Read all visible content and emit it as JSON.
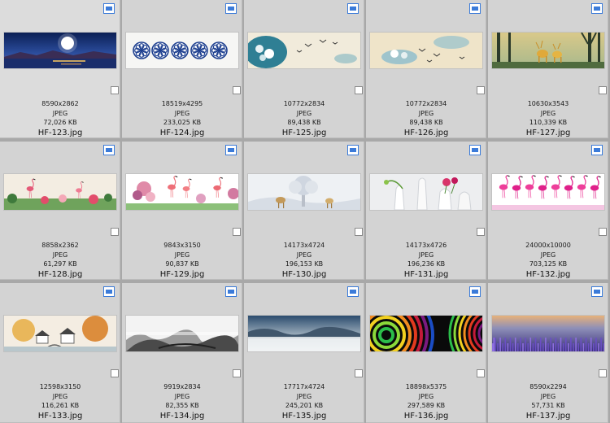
{
  "files": [
    {
      "name": "HF-123.jpg",
      "dims": "8590x2862",
      "type": "JPEG",
      "size": "72,026 KB",
      "thumb": "night-moon-lake"
    },
    {
      "name": "HF-124.jpg",
      "dims": "18519x4295",
      "type": "JPEG",
      "size": "233,025 KB",
      "thumb": "blue-porcelain-medallions"
    },
    {
      "name": "HF-125.jpg",
      "dims": "10772x2834",
      "type": "JPEG",
      "size": "89,438 KB",
      "thumb": "lotus-birds-teal"
    },
    {
      "name": "HF-126.jpg",
      "dims": "10772x2834",
      "type": "JPEG",
      "size": "89,438 KB",
      "thumb": "lotus-birds-cream"
    },
    {
      "name": "HF-127.jpg",
      "dims": "10630x3543",
      "type": "JPEG",
      "size": "110,339 KB",
      "thumb": "deer-forest-gold"
    },
    {
      "name": "HF-128.jpg",
      "dims": "8858x2362",
      "type": "JPEG",
      "size": "61,297 KB",
      "thumb": "flamingo-tropical"
    },
    {
      "name": "HF-129.jpg",
      "dims": "9843x3150",
      "type": "JPEG",
      "size": "90,837 KB",
      "thumb": "flamingo-flowers"
    },
    {
      "name": "HF-130.jpg",
      "dims": "14173x4724",
      "type": "JPEG",
      "size": "196,153 KB",
      "thumb": "white-tree-deer"
    },
    {
      "name": "HF-131.jpg",
      "dims": "14173x4726",
      "type": "JPEG",
      "size": "196,236 KB",
      "thumb": "white-vases-flowers"
    },
    {
      "name": "HF-132.jpg",
      "dims": "24000x10000",
      "type": "JPEG",
      "size": "703,125 KB",
      "thumb": "pink-flamingo-row"
    },
    {
      "name": "HF-133.jpg",
      "dims": "12598x3150",
      "type": "JPEG",
      "size": "116,261 KB",
      "thumb": "autumn-village"
    },
    {
      "name": "HF-134.jpg",
      "dims": "9919x2834",
      "type": "JPEG",
      "size": "82,355 KB",
      "thumb": "ink-mountains"
    },
    {
      "name": "HF-135.jpg",
      "dims": "17717x4724",
      "type": "JPEG",
      "size": "245,201 KB",
      "thumb": "misty-sea"
    },
    {
      "name": "HF-136.jpg",
      "dims": "18898x5375",
      "type": "JPEG",
      "size": "297,589 KB",
      "thumb": "rainbow-rings"
    },
    {
      "name": "HF-137.jpg",
      "dims": "8590x2294",
      "type": "JPEG",
      "size": "57,731 KB",
      "thumb": "lavender-field"
    }
  ],
  "icons": {
    "filetype": "image-file-icon",
    "checkbox": "select-checkbox"
  }
}
